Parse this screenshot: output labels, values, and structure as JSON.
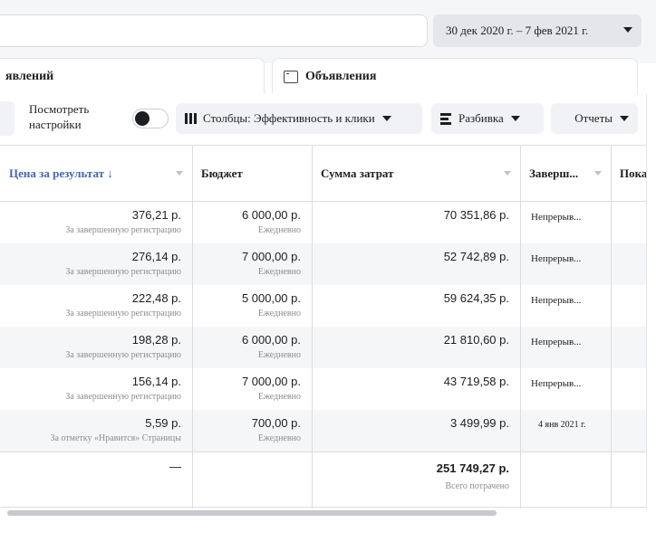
{
  "date_range": "30 дек 2020 г. – 7 фев 2021 г.",
  "tabs": {
    "left_partial": "явлений",
    "ads": "Объявления"
  },
  "toolbar": {
    "view_settings": "Посмотреть настройки",
    "columns": "Столбцы: Эффективность и клики",
    "breakdown": "Разбивка",
    "reports": "Отчеты"
  },
  "table": {
    "headers": {
      "price": "Цена за результат ↓",
      "budget": "Бюджет",
      "spend": "Сумма затрат",
      "ends": "Заверш...",
      "shows": "Пока"
    },
    "rows": [
      {
        "price": "376,21 р.",
        "price_sub": "За завершенную регистрацию",
        "budget": "6 000,00 р.",
        "budget_sub": "Ежедневно",
        "spend": "70 351,86 р.",
        "ends": "Непрерыв..."
      },
      {
        "price": "276,14 р.",
        "price_sub": "За завершенную регистрацию",
        "budget": "7 000,00 р.",
        "budget_sub": "Ежедневно",
        "spend": "52 742,89 р.",
        "ends": "Непрерыв..."
      },
      {
        "price": "222,48 р.",
        "price_sub": "За завершенную регистрацию",
        "budget": "5 000,00 р.",
        "budget_sub": "Ежедневно",
        "spend": "59 624,35 р.",
        "ends": "Непрерыв..."
      },
      {
        "price": "198,28 р.",
        "price_sub": "За завершенную регистрацию",
        "budget": "6 000,00 р.",
        "budget_sub": "Ежедневно",
        "spend": "21 810,60 р.",
        "ends": "Непрерыв..."
      },
      {
        "price": "156,14 р.",
        "price_sub": "За завершенную регистрацию",
        "budget": "7 000,00 р.",
        "budget_sub": "Ежедневно",
        "spend": "43 719,58 р.",
        "ends": "Непрерыв..."
      },
      {
        "price": "5,59 р.",
        "price_sub": "За отметку «Нравится» Страницы",
        "budget": "700,00 р.",
        "budget_sub": "Ежедневно",
        "spend": "3 499,99 р.",
        "ends": "4 янв 2021 г."
      }
    ],
    "totals": {
      "price": "—",
      "spend": "251 749,27 р.",
      "spend_sub": "Всего потрачено"
    }
  },
  "colors": {
    "link_blue": "#385898",
    "page_bg": "#f5f6f7"
  }
}
